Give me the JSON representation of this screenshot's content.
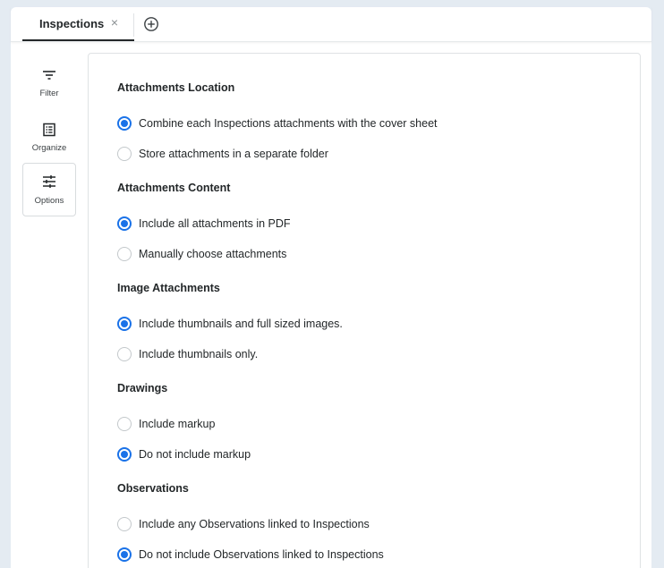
{
  "tab": {
    "label": "Inspections",
    "close_glyph": "×"
  },
  "icons": {
    "close": "close-icon",
    "add_tab": "plus-circle-icon",
    "filter": "filter-icon",
    "organize": "list-box-icon",
    "options": "sliders-icon"
  },
  "sidebar": {
    "items": [
      {
        "label": "Filter"
      },
      {
        "label": "Organize"
      },
      {
        "label": "Options"
      }
    ]
  },
  "colors": {
    "accent": "#1a72e8",
    "background": "#e4ebf2",
    "text": "#232729"
  },
  "sections": [
    {
      "title": "Attachments Location",
      "options": [
        {
          "label": "Combine each Inspections attachments with the cover sheet",
          "checked": true
        },
        {
          "label": "Store attachments in a separate folder",
          "checked": false
        }
      ]
    },
    {
      "title": "Attachments Content",
      "options": [
        {
          "label": "Include all attachments in PDF",
          "checked": true
        },
        {
          "label": "Manually choose attachments",
          "checked": false
        }
      ]
    },
    {
      "title": "Image Attachments",
      "options": [
        {
          "label": "Include thumbnails and full sized images.",
          "checked": true
        },
        {
          "label": "Include thumbnails only.",
          "checked": false
        }
      ]
    },
    {
      "title": "Drawings",
      "options": [
        {
          "label": "Include markup",
          "checked": false
        },
        {
          "label": "Do not include markup",
          "checked": true
        }
      ]
    },
    {
      "title": "Observations",
      "options": [
        {
          "label": "Include any Observations linked to Inspections",
          "checked": false
        },
        {
          "label": "Do not include Observations linked to Inspections",
          "checked": true
        }
      ]
    }
  ]
}
